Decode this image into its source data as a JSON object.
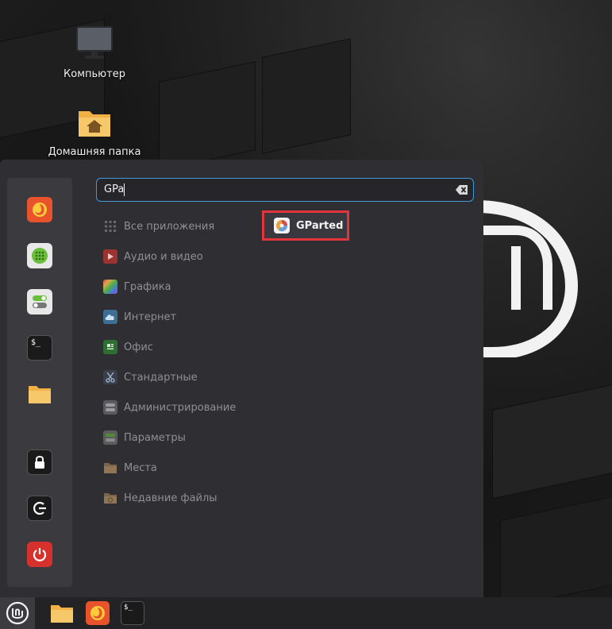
{
  "desktop": {
    "icons": [
      {
        "label": "Компьютер"
      },
      {
        "label": "Домашняя папка"
      }
    ]
  },
  "search": {
    "value": "GPa"
  },
  "categories": [
    {
      "label": "Все приложения",
      "icon": "grid-icon",
      "color": "#5a5a60"
    },
    {
      "label": "Аудио и видео",
      "icon": "play-icon",
      "color": "#c0392b"
    },
    {
      "label": "Графика",
      "icon": "palette-icon",
      "color": "#8e44ad"
    },
    {
      "label": "Интернет",
      "icon": "cloud-icon",
      "color": "#4a90c2"
    },
    {
      "label": "Офис",
      "icon": "document-icon",
      "color": "#3a8a3a"
    },
    {
      "label": "Стандартные",
      "icon": "scissors-icon",
      "color": "#4a7fb0"
    },
    {
      "label": "Администрирование",
      "icon": "toggle-icon",
      "color": "#707078"
    },
    {
      "label": "Параметры",
      "icon": "settings-toggle-icon",
      "color": "#6b7a6b"
    },
    {
      "label": "Места",
      "icon": "folder-icon",
      "color": "#8a7555"
    },
    {
      "label": "Недавние файлы",
      "icon": "recent-folder-icon",
      "color": "#8a7555"
    }
  ],
  "result": {
    "label": "GParted",
    "icon": "gparted-icon"
  },
  "favorites": [
    {
      "icon": "firefox-icon",
      "color": "#e8532b"
    },
    {
      "icon": "software-manager-icon",
      "color": "#e8e8e8"
    },
    {
      "icon": "system-settings-icon",
      "color": "#e8e8e8"
    },
    {
      "icon": "terminal-icon",
      "color": "#1a1a1a"
    },
    {
      "icon": "files-icon",
      "color": "#f5c96a"
    },
    {
      "icon": "lock-screen-icon",
      "color": "#1a1a1a"
    },
    {
      "icon": "logout-icon",
      "color": "#1a1a1a"
    },
    {
      "icon": "shutdown-icon",
      "color": "#d6312c"
    }
  ],
  "taskbar": [
    {
      "icon": "files-icon"
    },
    {
      "icon": "firefox-icon"
    },
    {
      "icon": "terminal-icon"
    }
  ],
  "terminal_glyph": "$_"
}
